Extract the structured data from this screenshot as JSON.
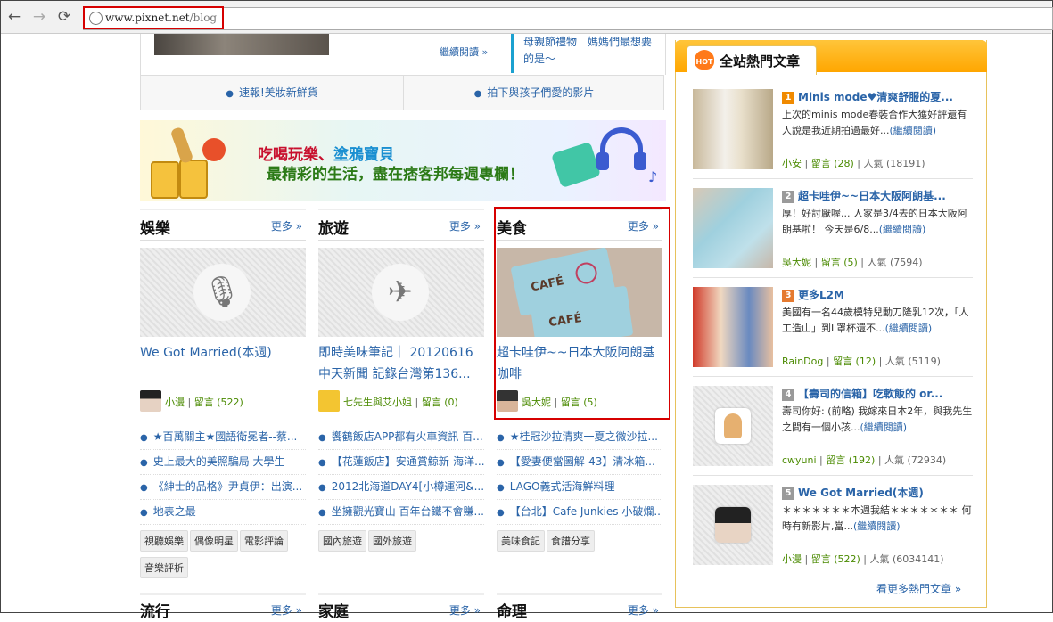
{
  "browser": {
    "url_host": "www.pixnet.net",
    "url_path": "/blog"
  },
  "top_section": {
    "continue_link": "繼續閱讀 »",
    "promo_text": "母親節禮物　媽媽們最想要的是～",
    "links": [
      "速報!美妝新鮮貨",
      "拍下與孩子們愛的影片"
    ]
  },
  "banner": {
    "line1_red": "吃喝玩樂、",
    "line1_blue": "塗鴉寶貝",
    "line2": "最精彩的生活，盡在痞客邦每週專欄！"
  },
  "columns": [
    {
      "title": "娛樂",
      "more": "更多 »",
      "icon": "microphone-icon",
      "article_title": "We Got Married(本週)",
      "author": "小漫",
      "comments": "留言 (522)",
      "posts": [
        "★百萬關主★國語衛冕者--蔡...",
        "史上最大的美照騙局 大學生",
        "《紳士的品格》尹貞伊：出演...",
        "地表之最"
      ],
      "tags": [
        "視聽娛樂",
        "偶像明星",
        "電影評論",
        "音樂評析"
      ]
    },
    {
      "title": "旅遊",
      "more": "更多 »",
      "icon": "airplane-icon",
      "article_title": "即時美味筆記｜ 20120616 中天新聞 記錄台灣第136...",
      "author": "七先生與艾小姐",
      "comments": "留言 (0)",
      "posts": [
        "饗鶴飯店APP都有火車資訊 百...",
        "【花蓮飯店】安通賞鯨新-海洋...",
        "2012北海道DAY4[小樽運河&...",
        "坐擁觀光寶山 百年台鐵不會賺..."
      ],
      "tags": [
        "國內旅遊",
        "國外旅遊"
      ]
    },
    {
      "title": "美食",
      "more": "更多 »",
      "icon": "cafe-card-photo",
      "article_title": "超卡哇伊~~日本大阪阿朗基咖啡",
      "author": "吳大妮",
      "comments": "留言 (5)",
      "posts": [
        "★桂冠沙拉清爽一夏之微沙拉...",
        "【愛妻便當圖解-43】清冰箱...",
        "LAGO義式活海鮮料理",
        "【台北】Cafe Junkies 小破爛..."
      ],
      "tags": [
        "美味食記",
        "食譜分享"
      ]
    }
  ],
  "bottom_columns": [
    {
      "title": "流行",
      "more": "更多 »"
    },
    {
      "title": "家庭",
      "more": "更多 »"
    },
    {
      "title": "命理",
      "more": "更多 »"
    }
  ],
  "hot": {
    "hot_badge": "HOT",
    "title": "全站熱門文章",
    "more": "看更多熱門文章 »",
    "items": [
      {
        "rank": "1",
        "rank_color": "#f08a00",
        "title": "Minis mode♥清爽舒服的夏...",
        "desc": "上次的minis mode春裝合作大獲好評還有人說是我近期拍過最好...",
        "read": "(繼續閱讀)",
        "author": "小安",
        "comments": "留言 (28)",
        "popularity": "人氣 (18191)"
      },
      {
        "rank": "2",
        "rank_color": "#9a9a9a",
        "title": "超卡哇伊~~日本大阪阿朗基...",
        "desc": "厚！好討厭喔... 人家是3/4去的日本大阪阿朗基啦！ 今天是6/8...",
        "read": "(繼續閱讀)",
        "author": "吳大妮",
        "comments": "留言 (5)",
        "popularity": "人氣 (7594)"
      },
      {
        "rank": "3",
        "rank_color": "#e57a30",
        "title": "更多L2M",
        "desc": "美國有一名44歲模特兒動刀隆乳12次，「人工造山」到L罩杯還不...",
        "read": "(繼續閱讀)",
        "author": "RainDog",
        "comments": "留言 (12)",
        "popularity": "人氣 (5119)"
      },
      {
        "rank": "4",
        "rank_color": "#9a9a9a",
        "title": "【壽司的信箱】吃軟飯的 or...",
        "desc": "壽司你好: (前略) 我嫁來日本2年，與我先生之間有一個小孩...",
        "read": "(繼續閱讀)",
        "author": "cwyuni",
        "comments": "留言 (192)",
        "popularity": "人氣 (72934)"
      },
      {
        "rank": "5",
        "rank_color": "#9a9a9a",
        "title": "We Got Married(本週)",
        "desc": "＊＊＊＊＊＊＊本週我結＊＊＊＊＊＊＊ 何時有新影片,當...",
        "read": "(繼續閱讀)",
        "author": "小漫",
        "comments": "留言 (522)",
        "popularity": "人氣 (6034141)"
      }
    ]
  }
}
